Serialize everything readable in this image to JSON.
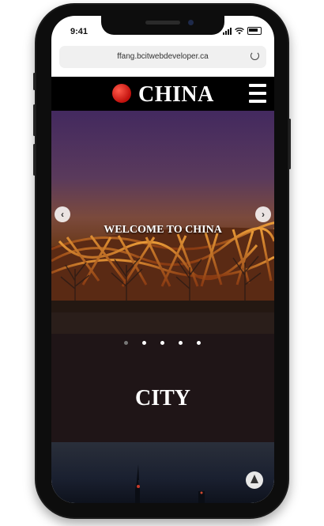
{
  "status": {
    "time": "9:41"
  },
  "browser": {
    "url": "ffang.bcitwebdeveloper.ca"
  },
  "navbar": {
    "brand": "CHINA"
  },
  "hero": {
    "title": "WELCOME TO CHINA",
    "prev": "‹",
    "next": "›",
    "active_slide": 1,
    "slide_count": 5
  },
  "section": {
    "title": "CITY"
  },
  "colors": {
    "accent": "#c0100c",
    "navbar": "#000000",
    "band": "#1f1517"
  }
}
